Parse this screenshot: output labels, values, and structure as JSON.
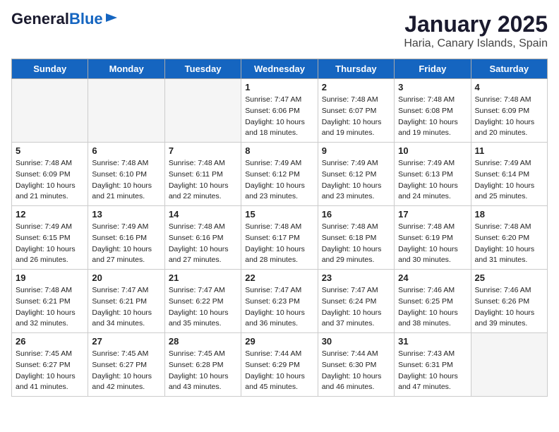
{
  "logo": {
    "line1": "General",
    "line2": "Blue"
  },
  "title": "January 2025",
  "subtitle": "Haria, Canary Islands, Spain",
  "weekdays": [
    "Sunday",
    "Monday",
    "Tuesday",
    "Wednesday",
    "Thursday",
    "Friday",
    "Saturday"
  ],
  "weeks": [
    [
      {
        "day": "",
        "sunrise": "",
        "sunset": "",
        "daylight": ""
      },
      {
        "day": "",
        "sunrise": "",
        "sunset": "",
        "daylight": ""
      },
      {
        "day": "",
        "sunrise": "",
        "sunset": "",
        "daylight": ""
      },
      {
        "day": "1",
        "sunrise": "7:47 AM",
        "sunset": "6:06 PM",
        "daylight": "10 hours and 18 minutes."
      },
      {
        "day": "2",
        "sunrise": "7:48 AM",
        "sunset": "6:07 PM",
        "daylight": "10 hours and 19 minutes."
      },
      {
        "day": "3",
        "sunrise": "7:48 AM",
        "sunset": "6:08 PM",
        "daylight": "10 hours and 19 minutes."
      },
      {
        "day": "4",
        "sunrise": "7:48 AM",
        "sunset": "6:09 PM",
        "daylight": "10 hours and 20 minutes."
      }
    ],
    [
      {
        "day": "5",
        "sunrise": "7:48 AM",
        "sunset": "6:09 PM",
        "daylight": "10 hours and 21 minutes."
      },
      {
        "day": "6",
        "sunrise": "7:48 AM",
        "sunset": "6:10 PM",
        "daylight": "10 hours and 21 minutes."
      },
      {
        "day": "7",
        "sunrise": "7:48 AM",
        "sunset": "6:11 PM",
        "daylight": "10 hours and 22 minutes."
      },
      {
        "day": "8",
        "sunrise": "7:49 AM",
        "sunset": "6:12 PM",
        "daylight": "10 hours and 23 minutes."
      },
      {
        "day": "9",
        "sunrise": "7:49 AM",
        "sunset": "6:12 PM",
        "daylight": "10 hours and 23 minutes."
      },
      {
        "day": "10",
        "sunrise": "7:49 AM",
        "sunset": "6:13 PM",
        "daylight": "10 hours and 24 minutes."
      },
      {
        "day": "11",
        "sunrise": "7:49 AM",
        "sunset": "6:14 PM",
        "daylight": "10 hours and 25 minutes."
      }
    ],
    [
      {
        "day": "12",
        "sunrise": "7:49 AM",
        "sunset": "6:15 PM",
        "daylight": "10 hours and 26 minutes."
      },
      {
        "day": "13",
        "sunrise": "7:49 AM",
        "sunset": "6:16 PM",
        "daylight": "10 hours and 27 minutes."
      },
      {
        "day": "14",
        "sunrise": "7:48 AM",
        "sunset": "6:16 PM",
        "daylight": "10 hours and 27 minutes."
      },
      {
        "day": "15",
        "sunrise": "7:48 AM",
        "sunset": "6:17 PM",
        "daylight": "10 hours and 28 minutes."
      },
      {
        "day": "16",
        "sunrise": "7:48 AM",
        "sunset": "6:18 PM",
        "daylight": "10 hours and 29 minutes."
      },
      {
        "day": "17",
        "sunrise": "7:48 AM",
        "sunset": "6:19 PM",
        "daylight": "10 hours and 30 minutes."
      },
      {
        "day": "18",
        "sunrise": "7:48 AM",
        "sunset": "6:20 PM",
        "daylight": "10 hours and 31 minutes."
      }
    ],
    [
      {
        "day": "19",
        "sunrise": "7:48 AM",
        "sunset": "6:21 PM",
        "daylight": "10 hours and 32 minutes."
      },
      {
        "day": "20",
        "sunrise": "7:47 AM",
        "sunset": "6:21 PM",
        "daylight": "10 hours and 34 minutes."
      },
      {
        "day": "21",
        "sunrise": "7:47 AM",
        "sunset": "6:22 PM",
        "daylight": "10 hours and 35 minutes."
      },
      {
        "day": "22",
        "sunrise": "7:47 AM",
        "sunset": "6:23 PM",
        "daylight": "10 hours and 36 minutes."
      },
      {
        "day": "23",
        "sunrise": "7:47 AM",
        "sunset": "6:24 PM",
        "daylight": "10 hours and 37 minutes."
      },
      {
        "day": "24",
        "sunrise": "7:46 AM",
        "sunset": "6:25 PM",
        "daylight": "10 hours and 38 minutes."
      },
      {
        "day": "25",
        "sunrise": "7:46 AM",
        "sunset": "6:26 PM",
        "daylight": "10 hours and 39 minutes."
      }
    ],
    [
      {
        "day": "26",
        "sunrise": "7:45 AM",
        "sunset": "6:27 PM",
        "daylight": "10 hours and 41 minutes."
      },
      {
        "day": "27",
        "sunrise": "7:45 AM",
        "sunset": "6:27 PM",
        "daylight": "10 hours and 42 minutes."
      },
      {
        "day": "28",
        "sunrise": "7:45 AM",
        "sunset": "6:28 PM",
        "daylight": "10 hours and 43 minutes."
      },
      {
        "day": "29",
        "sunrise": "7:44 AM",
        "sunset": "6:29 PM",
        "daylight": "10 hours and 45 minutes."
      },
      {
        "day": "30",
        "sunrise": "7:44 AM",
        "sunset": "6:30 PM",
        "daylight": "10 hours and 46 minutes."
      },
      {
        "day": "31",
        "sunrise": "7:43 AM",
        "sunset": "6:31 PM",
        "daylight": "10 hours and 47 minutes."
      },
      {
        "day": "",
        "sunrise": "",
        "sunset": "",
        "daylight": ""
      }
    ]
  ],
  "labels": {
    "sunrise_prefix": "Sunrise: ",
    "sunset_prefix": "Sunset: ",
    "daylight_prefix": "Daylight: "
  }
}
